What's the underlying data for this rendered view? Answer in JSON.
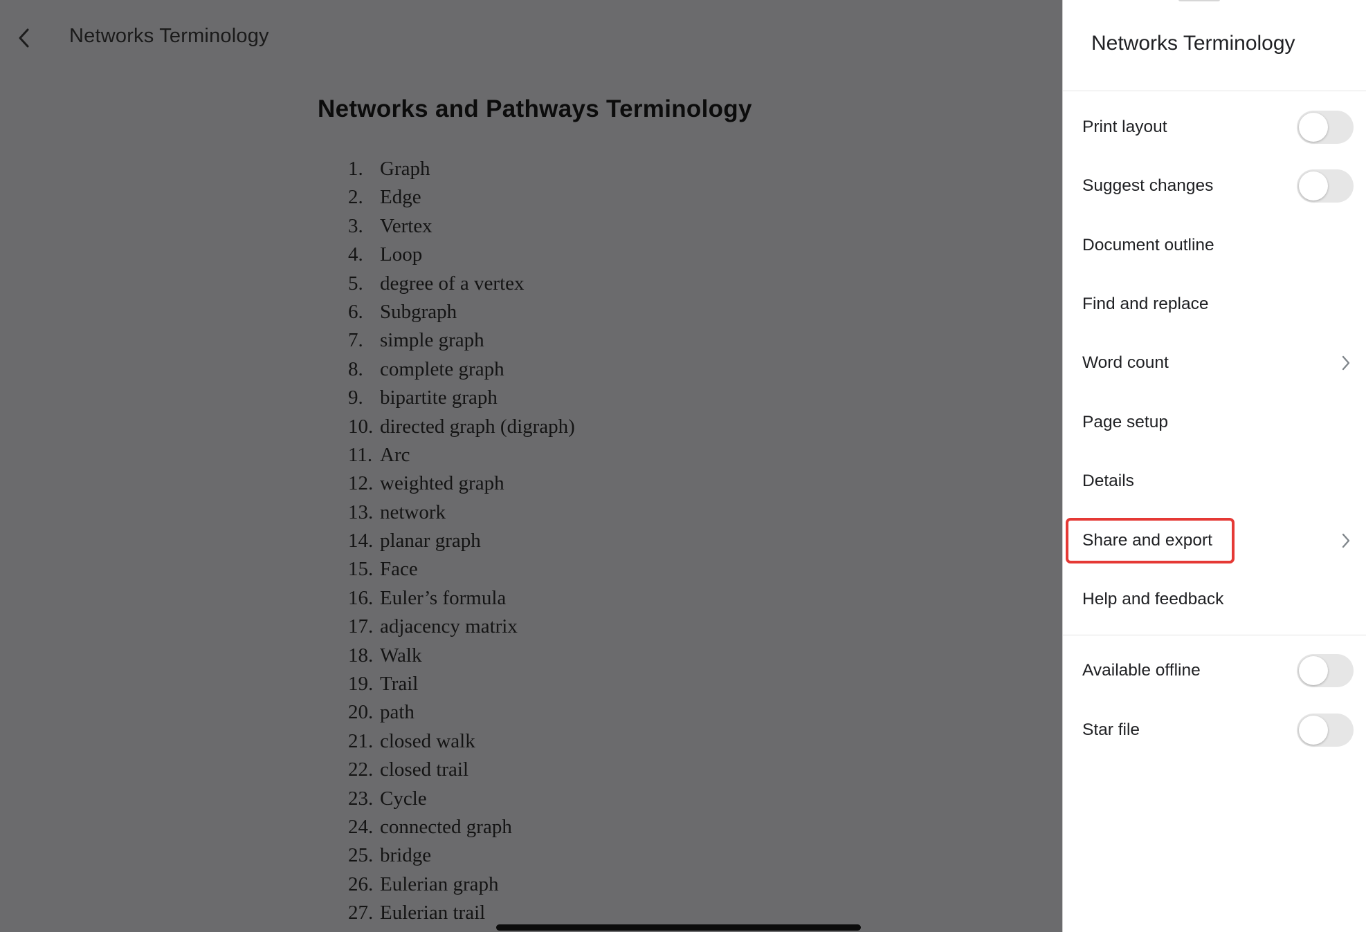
{
  "header": {
    "back_icon": "chevron-left-icon",
    "title": "Networks Terminology"
  },
  "document": {
    "heading": "Networks and Pathways Terminology",
    "terms": [
      {
        "num": "1.",
        "text": "Graph"
      },
      {
        "num": "2.",
        "text": "Edge"
      },
      {
        "num": "3.",
        "text": "Vertex"
      },
      {
        "num": "4.",
        "text": "Loop"
      },
      {
        "num": "5.",
        "text": "degree of a vertex"
      },
      {
        "num": "6.",
        "text": "Subgraph"
      },
      {
        "num": "7.",
        "text": "simple graph"
      },
      {
        "num": "8.",
        "text": "complete graph"
      },
      {
        "num": "9.",
        "text": "bipartite graph"
      },
      {
        "num": "10.",
        "text": "directed graph (digraph)"
      },
      {
        "num": "11.",
        "text": "Arc"
      },
      {
        "num": "12.",
        "text": "weighted graph"
      },
      {
        "num": "13.",
        "text": "network"
      },
      {
        "num": "14.",
        "text": "planar graph"
      },
      {
        "num": "15.",
        "text": "Face"
      },
      {
        "num": "16.",
        "text": "Euler’s formula"
      },
      {
        "num": "17.",
        "text": "adjacency matrix"
      },
      {
        "num": "18.",
        "text": "Walk"
      },
      {
        "num": "19.",
        "text": "Trail"
      },
      {
        "num": "20.",
        "text": "path"
      },
      {
        "num": "21.",
        "text": "closed walk"
      },
      {
        "num": "22.",
        "text": "closed trail"
      },
      {
        "num": "23.",
        "text": "Cycle"
      },
      {
        "num": "24.",
        "text": "connected graph"
      },
      {
        "num": "25.",
        "text": "bridge"
      },
      {
        "num": "26.",
        "text": "Eulerian graph"
      },
      {
        "num": "27.",
        "text": "Eulerian trail"
      }
    ]
  },
  "panel": {
    "title": "Networks Terminology",
    "items": [
      {
        "label": "Print layout",
        "control": "toggle",
        "on": false
      },
      {
        "label": "Suggest changes",
        "control": "toggle",
        "on": false
      },
      {
        "label": "Document outline",
        "control": "none"
      },
      {
        "label": "Find and replace",
        "control": "none"
      },
      {
        "label": "Word count",
        "control": "chevron"
      },
      {
        "label": "Page setup",
        "control": "none"
      },
      {
        "label": "Details",
        "control": "none"
      },
      {
        "label": "Share and export",
        "control": "chevron",
        "highlighted": true
      },
      {
        "label": "Help and feedback",
        "control": "none"
      },
      {
        "label": "Available offline",
        "control": "toggle",
        "on": false
      },
      {
        "label": "Star file",
        "control": "toggle",
        "on": false
      }
    ]
  },
  "colors": {
    "overlay": "#6b6b6d",
    "panel_bg": "#ffffff",
    "highlight": "#e53935",
    "toggle_off": "#e6e6e6"
  }
}
